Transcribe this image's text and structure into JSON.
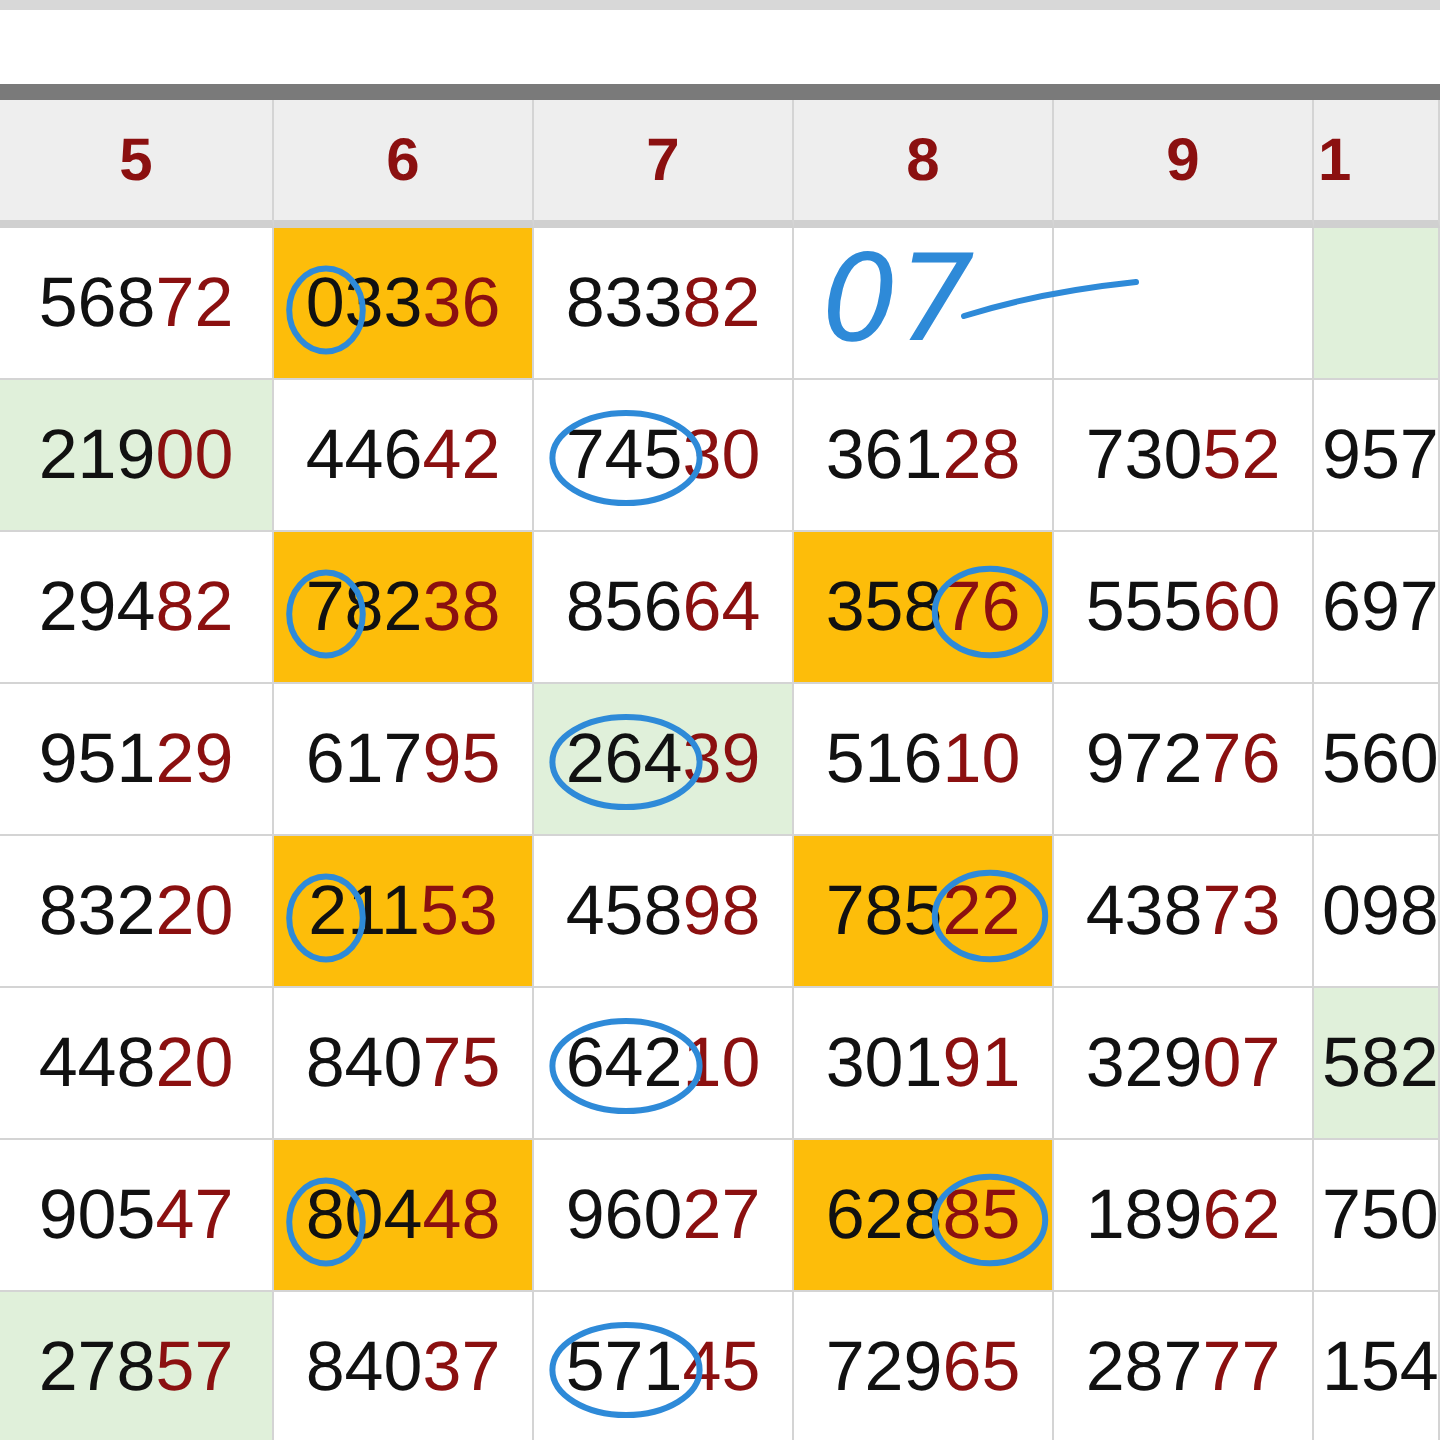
{
  "table": {
    "columns": [
      "5",
      "6",
      "7",
      "8",
      "9",
      "1"
    ],
    "rows": [
      [
        {
          "head": "568",
          "tail": "72",
          "color": "#ffffff"
        },
        {
          "head": "033",
          "tail": "36",
          "color": "#fdbd0a",
          "circle": {
            "kind": "first"
          }
        },
        {
          "head": "833",
          "tail": "82",
          "color": "#ffffff"
        },
        {
          "note": "07",
          "color": "#ffffff"
        },
        {
          "color": "#ffffff"
        },
        {
          "color": "#e0f0da"
        }
      ],
      [
        {
          "head": "219",
          "tail": "00",
          "color": "#e0f0da"
        },
        {
          "head": "446",
          "tail": "42",
          "color": "#ffffff"
        },
        {
          "head": "745",
          "tail": "30",
          "color": "#ffffff",
          "circle": {
            "kind": "front"
          }
        },
        {
          "head": "361",
          "tail": "28",
          "color": "#ffffff"
        },
        {
          "head": "730",
          "tail": "52",
          "color": "#ffffff"
        },
        {
          "head": "957",
          "color": "#ffffff"
        }
      ],
      [
        {
          "head": "294",
          "tail": "82",
          "color": "#ffffff"
        },
        {
          "head": "782",
          "tail": "38",
          "color": "#fdbd0a",
          "circle": {
            "kind": "first"
          }
        },
        {
          "head": "856",
          "tail": "64",
          "color": "#ffffff"
        },
        {
          "head": "358",
          "tail": "76",
          "color": "#fdbd0a",
          "circle": {
            "kind": "last"
          }
        },
        {
          "head": "555",
          "tail": "60",
          "color": "#ffffff"
        },
        {
          "head": "697",
          "color": "#ffffff"
        }
      ],
      [
        {
          "head": "951",
          "tail": "29",
          "color": "#ffffff"
        },
        {
          "head": "617",
          "tail": "95",
          "color": "#ffffff"
        },
        {
          "head": "264",
          "tail": "39",
          "color": "#e0f0da",
          "circle": {
            "kind": "front"
          }
        },
        {
          "head": "516",
          "tail": "10",
          "color": "#ffffff"
        },
        {
          "head": "972",
          "tail": "76",
          "color": "#ffffff"
        },
        {
          "head": "560",
          "color": "#ffffff"
        }
      ],
      [
        {
          "head": "832",
          "tail": "20",
          "color": "#ffffff"
        },
        {
          "head": "211",
          "tail": "53",
          "color": "#fdbd0a",
          "circle": {
            "kind": "first"
          }
        },
        {
          "head": "458",
          "tail": "98",
          "color": "#ffffff"
        },
        {
          "head": "785",
          "tail": "22",
          "color": "#fdbd0a",
          "circle": {
            "kind": "last"
          }
        },
        {
          "head": "438",
          "tail": "73",
          "color": "#ffffff"
        },
        {
          "head": "098",
          "color": "#ffffff"
        }
      ],
      [
        {
          "head": "448",
          "tail": "20",
          "color": "#ffffff"
        },
        {
          "head": "840",
          "tail": "75",
          "color": "#ffffff"
        },
        {
          "head": "642",
          "tail": "10",
          "color": "#ffffff",
          "circle": {
            "kind": "front"
          }
        },
        {
          "head": "301",
          "tail": "91",
          "color": "#ffffff"
        },
        {
          "head": "329",
          "tail": "07",
          "color": "#ffffff"
        },
        {
          "head": "582",
          "color": "#e0f0da"
        }
      ],
      [
        {
          "head": "905",
          "tail": "47",
          "color": "#ffffff"
        },
        {
          "head": "804",
          "tail": "48",
          "color": "#fdbd0a",
          "circle": {
            "kind": "first"
          }
        },
        {
          "head": "960",
          "tail": "27",
          "color": "#ffffff"
        },
        {
          "head": "628",
          "tail": "85",
          "color": "#fdbd0a",
          "circle": {
            "kind": "last"
          }
        },
        {
          "head": "189",
          "tail": "62",
          "color": "#ffffff"
        },
        {
          "head": "750",
          "color": "#ffffff"
        }
      ],
      [
        {
          "head": "278",
          "tail": "57",
          "color": "#e0f0da"
        },
        {
          "head": "840",
          "tail": "37",
          "color": "#ffffff"
        },
        {
          "head": "571",
          "tail": "45",
          "color": "#ffffff",
          "circle": {
            "kind": "front"
          }
        },
        {
          "head": "729",
          "tail": "65",
          "color": "#ffffff"
        },
        {
          "head": "287",
          "tail": "77",
          "color": "#ffffff"
        },
        {
          "head": "154",
          "color": "#ffffff"
        }
      ]
    ]
  }
}
